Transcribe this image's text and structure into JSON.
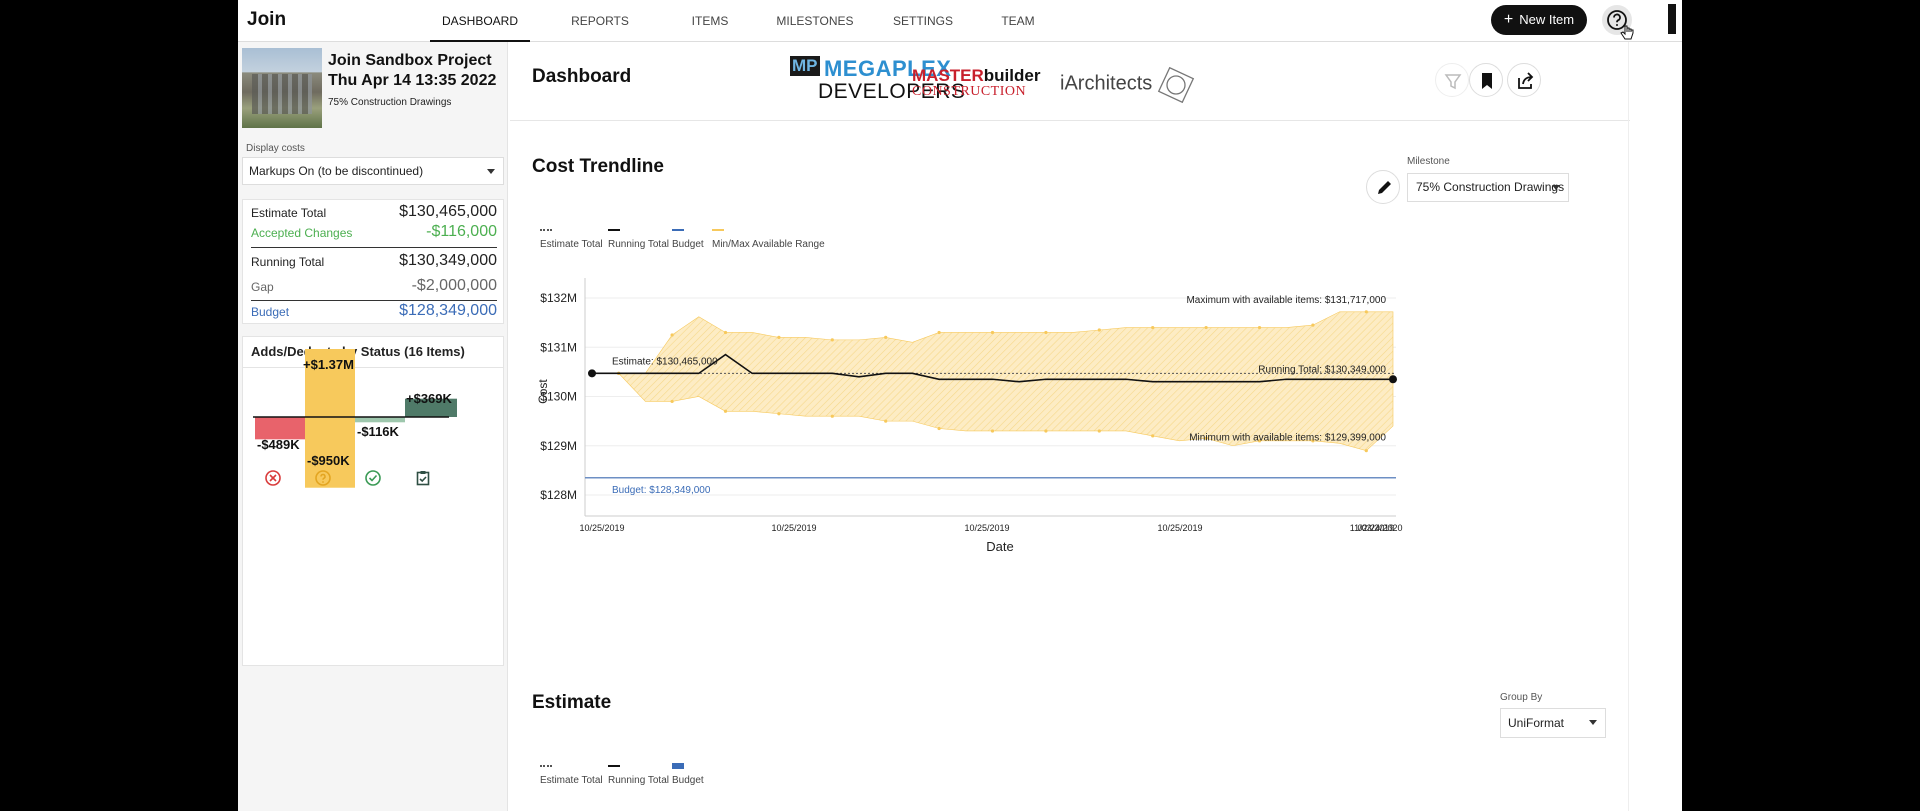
{
  "nav": {
    "logo": "Join",
    "tabs": [
      {
        "label": "DASHBOARD",
        "active": true
      },
      {
        "label": "REPORTS"
      },
      {
        "label": "ITEMS"
      },
      {
        "label": "MILESTONES"
      },
      {
        "label": "SETTINGS"
      },
      {
        "label": "TEAM"
      }
    ],
    "new_item_label": "New Item"
  },
  "project": {
    "name": "Join Sandbox Project",
    "date": "Thu Apr 14 13:35 2022",
    "milestone": "75% Construction Drawings"
  },
  "display_costs": {
    "label": "Display costs",
    "value": "Markups On (to be discontinued)"
  },
  "totals": {
    "estimate_label": "Estimate Total",
    "estimate_value": "$130,465,000",
    "accepted_label": "Accepted Changes",
    "accepted_value": "-$116,000",
    "running_label": "Running Total",
    "running_value": "$130,349,000",
    "gap_label": "Gap",
    "gap_value": "-$2,000,000",
    "budget_label": "Budget",
    "budget_value": "$128,349,000",
    "colors": {
      "accepted": "#4caf50",
      "budget": "#3b6cb7",
      "gap": "#666666"
    }
  },
  "adds_deducts": {
    "title": "Adds/Deducts by Status (16 Items)",
    "bars": [
      {
        "status": "rejected",
        "pos_label": "",
        "neg_label": "-$489K",
        "pos": 0,
        "neg": 489,
        "color": "#e8636b",
        "icon": "x-circle-icon"
      },
      {
        "status": "pending",
        "pos_label": "+$1.37M",
        "neg_label": "-$950K",
        "pos": 1370,
        "neg": 950,
        "color": "#f7c95c",
        "icon": "question-circle-icon"
      },
      {
        "status": "accepted",
        "pos_label": "",
        "neg_label": "-$116K",
        "pos": 0,
        "neg": 116,
        "color": "#9ec7ad",
        "icon": "check-circle-icon"
      },
      {
        "status": "incorporated",
        "pos_label": "+$369K",
        "neg_label": "",
        "pos": 369,
        "neg": 0,
        "color": "#4f7a68",
        "icon": "clipboard-check-icon"
      }
    ]
  },
  "dashboard": {
    "title": "Dashboard",
    "brands": {
      "megaplex_mp": "MP",
      "megaplex_top": "MEGAPLEX",
      "megaplex_bottom": "DEVELOPERS",
      "master_a": "MASTER",
      "master_b": "builder",
      "master_sub": "CONSTRUCTION",
      "iarch": "iArchitects"
    }
  },
  "trendline": {
    "title": "Cost Trendline",
    "milestone_label": "Milestone",
    "milestone_value": "75% Construction Drawings",
    "legend": [
      {
        "label": "Estimate Total",
        "color": "#555555",
        "style": "dotted"
      },
      {
        "label": "Running Total",
        "color": "#111111",
        "style": "solid"
      },
      {
        "label": "Budget",
        "color": "#3b6cb7",
        "style": "solid"
      },
      {
        "label": "Min/Max Available Range",
        "color": "#f7c95c",
        "style": "solid"
      }
    ]
  },
  "chart_data": {
    "type": "line",
    "xlabel": "Date",
    "ylabel": "Cost",
    "x_tick_labels": [
      "10/25/2019",
      "10/25/2019",
      "10/25/2019",
      "10/25/2019",
      "11/03/2019",
      "02/24/2020"
    ],
    "y_tick_labels": [
      "$132M",
      "$131M",
      "$130M",
      "$129M",
      "$128M"
    ],
    "y_ticks": [
      132,
      131,
      130,
      129,
      128
    ],
    "ylim": [
      127.8,
      132.4
    ],
    "n_points": 31,
    "series": [
      {
        "name": "Running Total",
        "values": [
          130.47,
          130.47,
          130.47,
          130.47,
          130.47,
          130.85,
          130.47,
          130.47,
          130.47,
          130.47,
          130.4,
          130.47,
          130.47,
          130.35,
          130.35,
          130.35,
          130.3,
          130.35,
          130.35,
          130.35,
          130.35,
          130.3,
          130.3,
          130.3,
          130.3,
          130.3,
          130.35,
          130.35,
          130.35,
          130.35,
          130.35
        ]
      },
      {
        "name": "Maximum",
        "values": [
          130.47,
          130.47,
          130.47,
          131.25,
          131.62,
          131.3,
          131.3,
          131.2,
          131.2,
          131.15,
          131.15,
          131.2,
          131.1,
          131.3,
          131.3,
          131.3,
          131.3,
          131.3,
          131.3,
          131.35,
          131.4,
          131.4,
          131.4,
          131.4,
          131.4,
          131.4,
          131.4,
          131.45,
          131.72,
          131.72,
          131.72
        ]
      },
      {
        "name": "Minimum",
        "values": [
          130.47,
          130.47,
          129.9,
          129.9,
          130.0,
          129.7,
          129.7,
          129.65,
          129.6,
          129.6,
          129.6,
          129.5,
          129.5,
          129.35,
          129.3,
          129.3,
          129.3,
          129.3,
          129.3,
          129.3,
          129.3,
          129.2,
          129.1,
          129.15,
          129.0,
          129.1,
          129.1,
          129.1,
          129.05,
          128.9,
          129.4
        ]
      }
    ],
    "budget": 128.349,
    "annotations": {
      "estimate": "Estimate: $130,465,000",
      "running": "Running Total: $130,349,000",
      "max": "Maximum with available items: $131,717,000",
      "min": "Minimum with available items: $129,399,000",
      "budget": "Budget: $128,349,000"
    },
    "colors": {
      "range": "#f7c95c",
      "running": "#111111",
      "budget": "#6d8fc4",
      "estimate": "#555555"
    },
    "grid": true
  },
  "estimate_section": {
    "title": "Estimate",
    "group_by_label": "Group By",
    "group_by_value": "UniFormat",
    "legend": [
      {
        "label": "Estimate Total",
        "color": "#555555",
        "style": "dotted"
      },
      {
        "label": "Running Total",
        "color": "#111111",
        "style": "solid"
      },
      {
        "label": "Budget",
        "color": "#3b6cb7",
        "style": "block"
      }
    ]
  }
}
